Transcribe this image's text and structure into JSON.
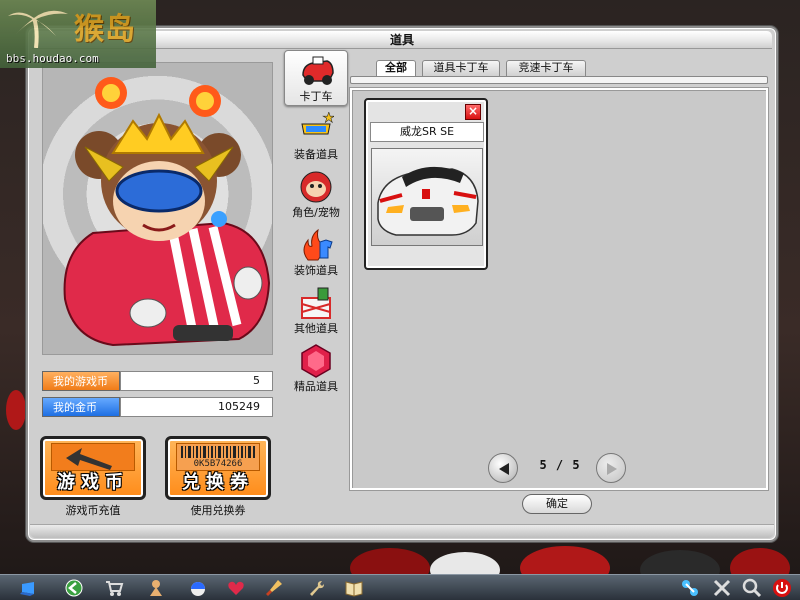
{
  "logo": {
    "brand": "猴岛",
    "url": "bbs.houdao.com"
  },
  "window": {
    "title": "道具"
  },
  "currency": {
    "game_coin_label": "我的游戏币",
    "game_coin_value": "5",
    "gold_coin_label": "我的金币",
    "gold_coin_value": "105249"
  },
  "buttons": {
    "recharge": {
      "text": "游戏币",
      "caption": "游戏币充值"
    },
    "voucher": {
      "text": "兑换券",
      "caption": "使用兑换券",
      "barcode_text": "0K5B74266"
    }
  },
  "categories": [
    {
      "label": "卡丁车",
      "active": true
    },
    {
      "label": "装备道具"
    },
    {
      "label": "角色/宠物"
    },
    {
      "label": "装饰道具"
    },
    {
      "label": "其他道具"
    },
    {
      "label": "精品道具"
    }
  ],
  "tabs": [
    {
      "label": "全部",
      "active": true
    },
    {
      "label": "道具卡丁车"
    },
    {
      "label": "竞速卡丁车"
    }
  ],
  "items": [
    {
      "name": "威龙SR SE",
      "close_glyph": "×"
    }
  ],
  "pager": {
    "text": "5 / 5"
  },
  "ok_button": {
    "label": "确定"
  },
  "colors": {
    "orange": "#f07c18",
    "blue": "#1e6fe3",
    "close_red": "#d81010"
  },
  "taskbar_icons": [
    "windows-icon",
    "back-icon",
    "cart-icon",
    "character-icon",
    "capsule-icon",
    "heart-icon",
    "brush-icon",
    "wrench-icon",
    "book-icon",
    "network-icon",
    "settings-icon",
    "search-icon",
    "power-icon"
  ]
}
